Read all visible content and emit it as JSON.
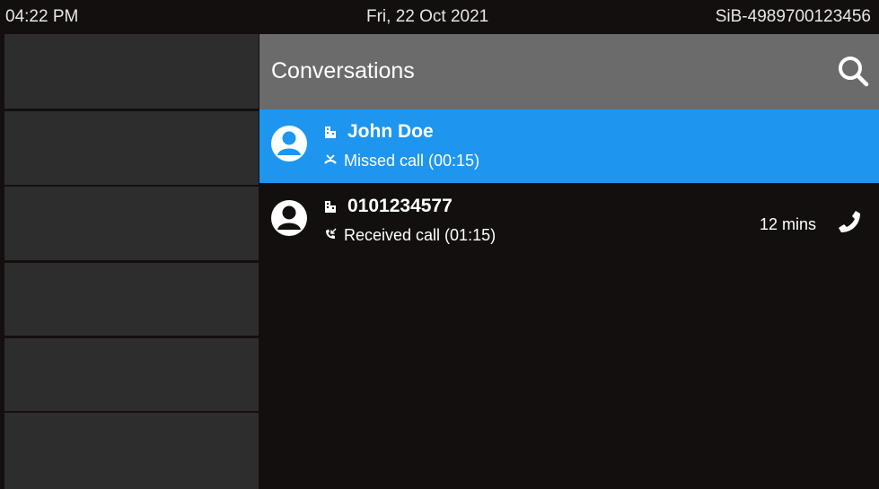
{
  "status": {
    "time": "04:22 PM",
    "date": "Fri, 22 Oct 2021",
    "device_id": "SiB-4989700123456"
  },
  "sidebar": {
    "keys": [
      "",
      "",
      "",
      "",
      "",
      ""
    ]
  },
  "header": {
    "title": "Conversations",
    "search_icon": "search-icon"
  },
  "conversations": [
    {
      "name": "John Doe",
      "type_icon": "building-icon",
      "status_icon": "missed-call-icon",
      "status": "Missed call (00:15)",
      "selected": true
    },
    {
      "name": "0101234577",
      "type_icon": "building-icon",
      "status_icon": "received-call-icon",
      "status": "Received call (01:15)",
      "time": "12 mins",
      "action_icon": "phone-icon",
      "selected": false
    }
  ],
  "colors": {
    "background": "#140f0f",
    "sidebar_key": "#2d2d2d",
    "header": "#6b6b6b",
    "selected": "#1e96f0"
  }
}
